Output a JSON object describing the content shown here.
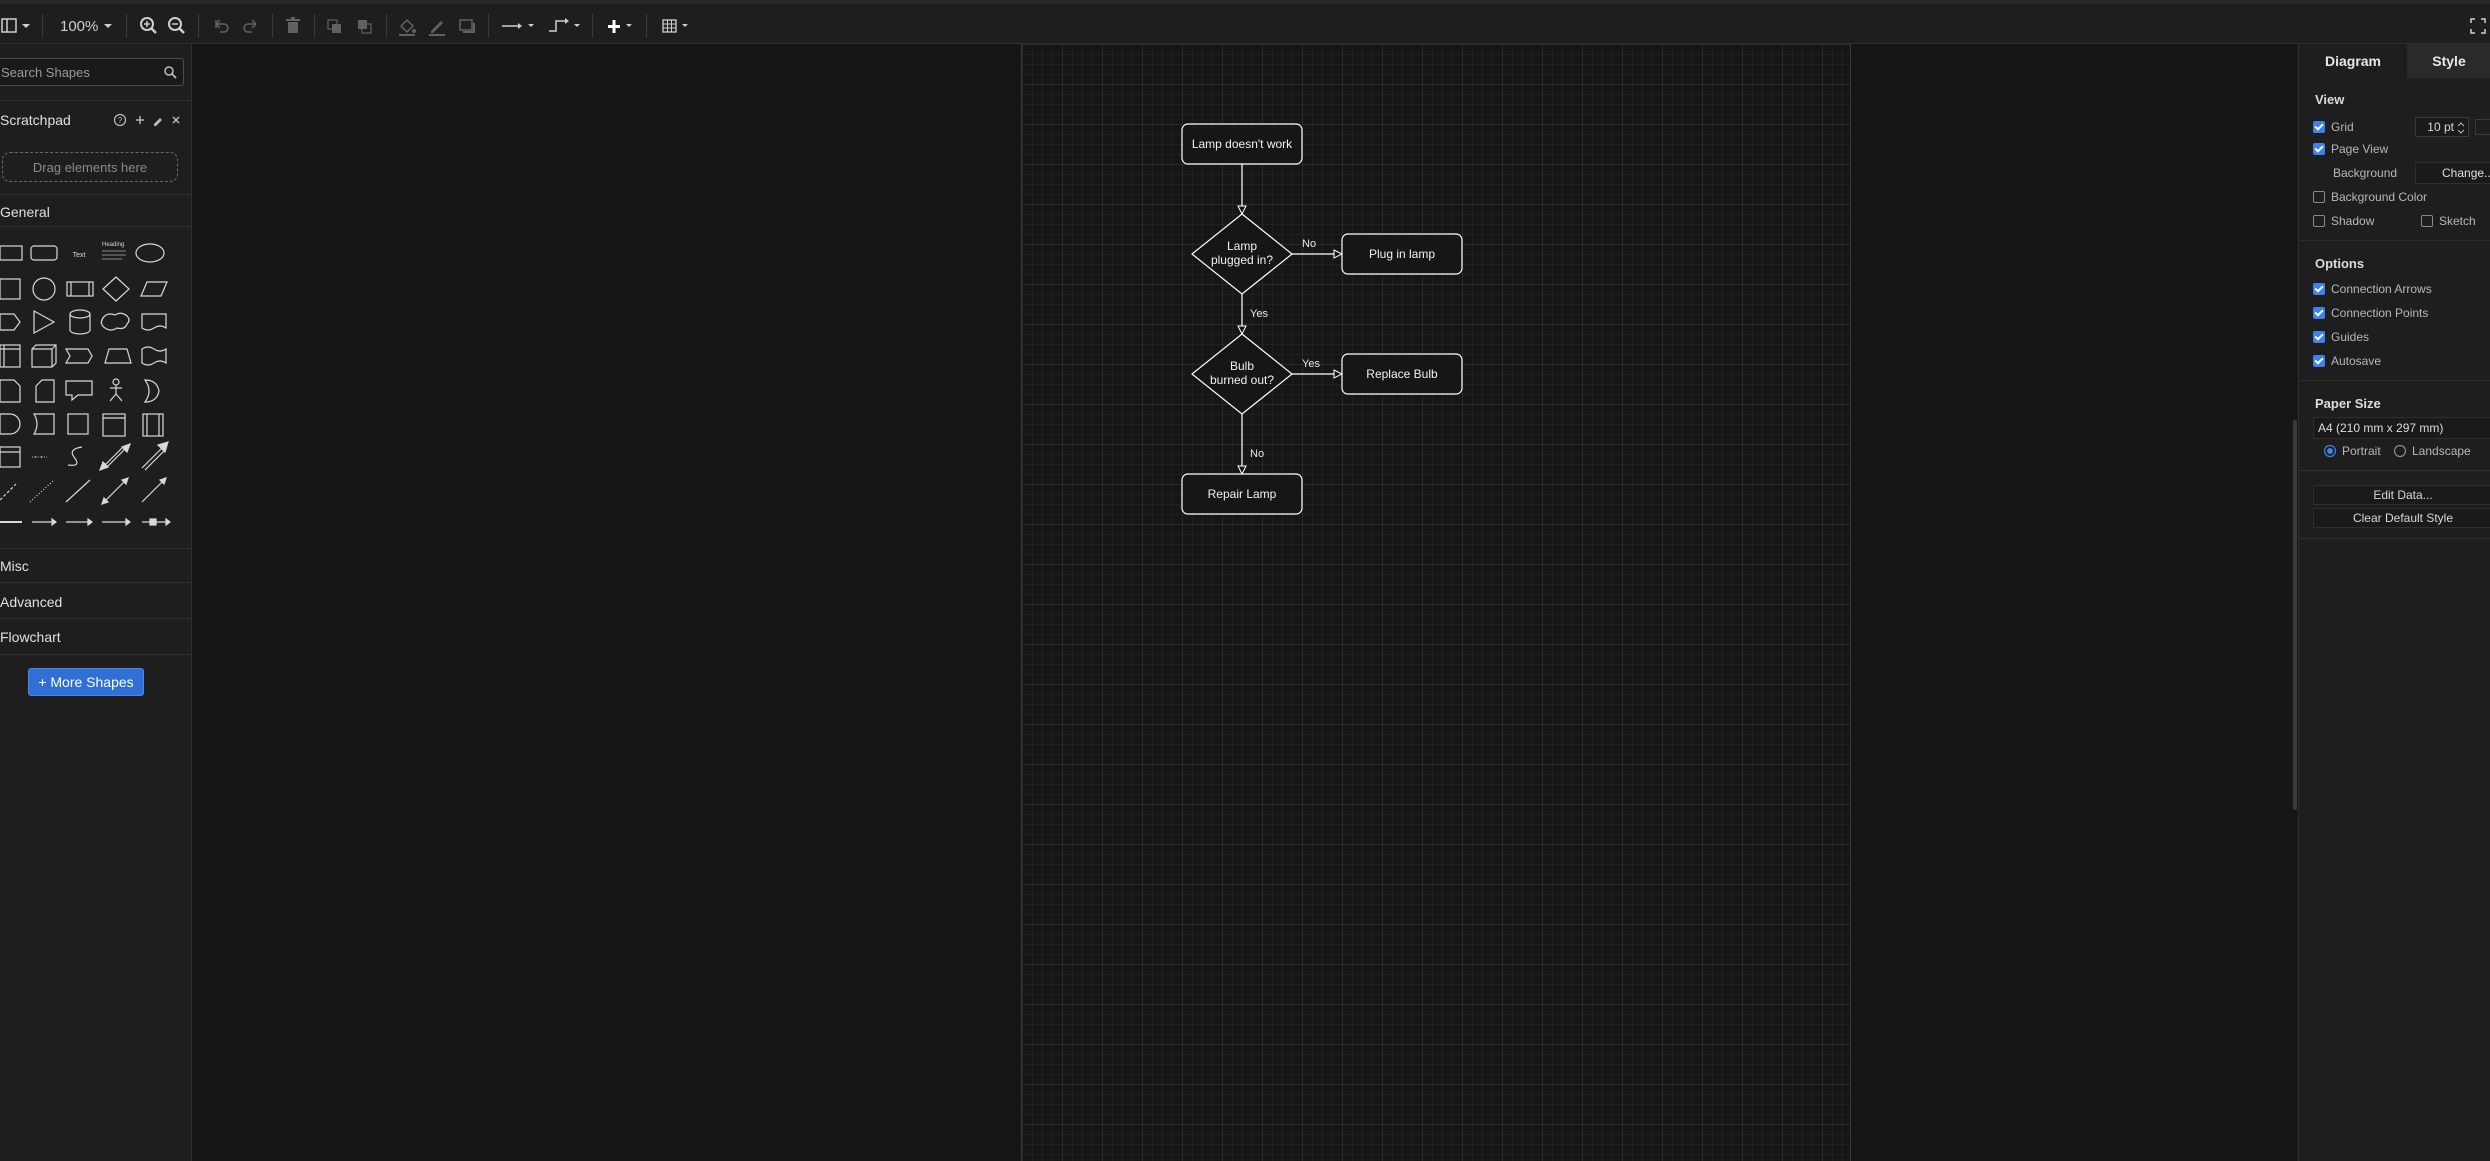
{
  "toolbar": {
    "zoom": "100%"
  },
  "sidebar": {
    "search_placeholder": "Search Shapes",
    "scratchpad_title": "Scratchpad",
    "drag_hint": "Drag elements here",
    "sections": [
      "General",
      "Misc",
      "Advanced",
      "Flowchart"
    ],
    "more_shapes": "+ More Shapes",
    "shape_samples": [
      "Text",
      "Heading"
    ]
  },
  "diagram": {
    "nodes": {
      "start": "Lamp doesn't work",
      "decision1": [
        "Lamp",
        "plugged in?"
      ],
      "action1": "Plug in lamp",
      "decision2": [
        "Bulb",
        "burned out?"
      ],
      "action2": "Replace Bulb",
      "end": "Repair Lamp"
    },
    "edges": {
      "d1_no": "No",
      "d1_yes": "Yes",
      "d2_yes": "Yes",
      "d2_no": "No"
    }
  },
  "right_panel": {
    "tabs": [
      "Diagram",
      "Style"
    ],
    "view_title": "View",
    "grid_label": "Grid",
    "grid_value": "10 pt",
    "page_view_label": "Page View",
    "background_label": "Background",
    "change_button": "Change...",
    "background_color_label": "Background Color",
    "shadow_label": "Shadow",
    "sketch_label": "Sketch",
    "options_title": "Options",
    "options": [
      "Connection Arrows",
      "Connection Points",
      "Guides",
      "Autosave"
    ],
    "paper_size_title": "Paper Size",
    "paper_size_value": "A4 (210 mm x 297 mm)",
    "portrait_label": "Portrait",
    "landscape_label": "Landscape",
    "edit_data": "Edit Data...",
    "clear_default_style": "Clear Default Style"
  },
  "colors": {
    "accent": "#3d82e8",
    "canvas": "#161616",
    "panel": "#1e1e1e",
    "shape_stroke": "#ffffff"
  }
}
